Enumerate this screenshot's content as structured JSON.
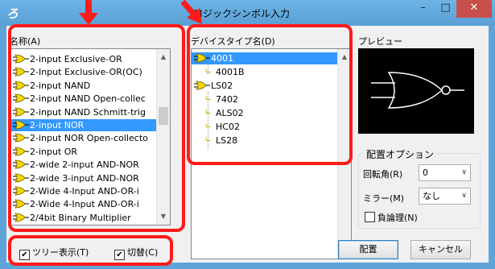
{
  "window": {
    "title": "ロジックシンボル入力",
    "minimize": "–",
    "maximize": "□",
    "close": "✕"
  },
  "name_list": {
    "label": "名称(A)",
    "items": [
      {
        "label": "2-input Exclusive-OR",
        "selected": false
      },
      {
        "label": "2-Input Exclusive-OR(OC)",
        "selected": false
      },
      {
        "label": "2-input NAND",
        "selected": false
      },
      {
        "label": "2-input NAND Open-collec",
        "selected": false
      },
      {
        "label": "2-input NAND Schmitt-trig",
        "selected": false
      },
      {
        "label": "2-input NOR",
        "selected": true
      },
      {
        "label": "2-input NOR Open-collecto",
        "selected": false
      },
      {
        "label": "2-input OR",
        "selected": false
      },
      {
        "label": "2-wide 2-input AND-NOR",
        "selected": false
      },
      {
        "label": "2-wide 3-input AND-NOR",
        "selected": false
      },
      {
        "label": "2-Wide 4-Input AND-OR-i",
        "selected": false
      },
      {
        "label": "2-Wide 4-Input AND-OR-i",
        "selected": false
      },
      {
        "label": "2/4bit Binary Multiplier",
        "selected": false
      }
    ]
  },
  "device_list": {
    "label": "デバイスタイプ名(D)",
    "items": [
      {
        "label": "4001",
        "level": 0,
        "selected": true
      },
      {
        "label": "4001B",
        "level": 1,
        "selected": false
      },
      {
        "label": "LS02",
        "level": 0,
        "selected": false
      },
      {
        "label": "7402",
        "level": 1,
        "selected": false
      },
      {
        "label": "ALS02",
        "level": 1,
        "selected": false
      },
      {
        "label": "HC02",
        "level": 1,
        "selected": false
      },
      {
        "label": "LS28",
        "level": 1,
        "selected": false
      }
    ]
  },
  "preview": {
    "label": "プレビュー"
  },
  "placement": {
    "group_label": "配置オプション",
    "rotation_label": "回転角(R)",
    "rotation_value": "0",
    "mirror_label": "ミラー(M)",
    "mirror_value": "なし",
    "negative_logic_label": "負論理(N)",
    "negative_logic_checked": false
  },
  "bottom": {
    "tree_view_label": "ツリー表示(T)",
    "tree_view_checked": true,
    "toggle_label": "切替(C)",
    "toggle_checked": true,
    "place_button": "配置",
    "cancel_button": "キャンセル"
  },
  "colors": {
    "annotation": "#ff1a1a",
    "selection": "#3399ff",
    "gate_fill": "#f5d800",
    "title_bar": "#5fa4d8"
  }
}
